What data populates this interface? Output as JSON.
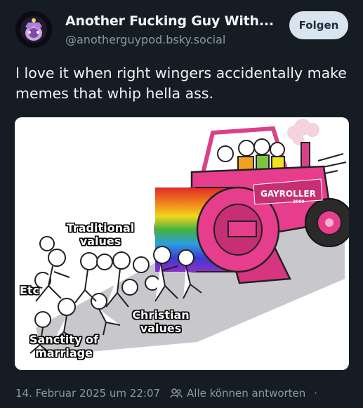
{
  "post": {
    "author_name": "Another Fucking Guy With...",
    "author_handle": "@anotherguypod.bsky.social",
    "follow_label": "Folgen",
    "text": "I love it when right wingers accidentally make memes that whip hella ass."
  },
  "meme": {
    "label_traditional": "Traditional values",
    "label_etc": "Etc",
    "label_christian": "Christian values",
    "label_sanctity": "Sanctity of marriage",
    "roller_text": "GAYROLLER",
    "roller_year": "2000"
  },
  "footer": {
    "timestamp": "14. Februar 2025 um 22:07",
    "reply_icon": "people-icon",
    "reply_setting": "Alle können antworten",
    "more_dot": "·"
  },
  "colors": {
    "background": "#151c24",
    "text_primary": "#f1f3f5",
    "text_secondary": "#8b98a5",
    "follow_bg": "#d9e4ee",
    "roller_pink": "#e63d8c"
  }
}
